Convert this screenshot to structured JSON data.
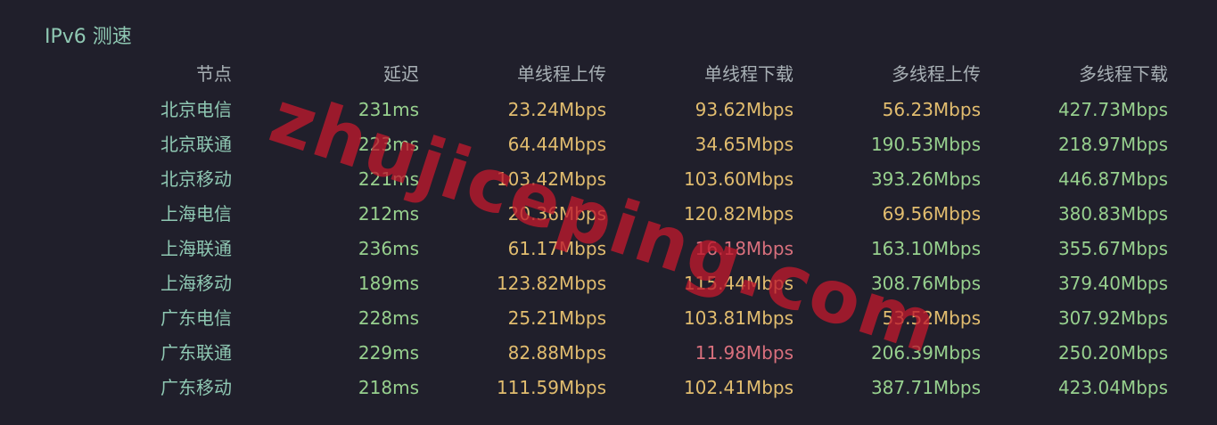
{
  "title": "IPv6 测速",
  "watermark": "zhujiceping.com",
  "colors": {
    "background": "#201f2b",
    "node_label": "#8fc8b3",
    "header": "#a8b0b5",
    "good": "#97d08e",
    "medium": "#e2bd6f",
    "poor": "#d9707d",
    "watermark": "#be192d"
  },
  "table": {
    "headers": [
      "节点",
      "延迟",
      "单线程上传",
      "单线程下载",
      "多线程上传",
      "多线程下载"
    ],
    "rows": [
      {
        "cells": [
          "北京电信",
          "231ms",
          "23.24Mbps",
          "93.62Mbps",
          "56.23Mbps",
          "427.73Mbps"
        ],
        "status": [
          "node",
          "good",
          "medium",
          "medium",
          "medium",
          "good"
        ]
      },
      {
        "cells": [
          "北京联通",
          "223ms",
          "64.44Mbps",
          "34.65Mbps",
          "190.53Mbps",
          "218.97Mbps"
        ],
        "status": [
          "node",
          "good",
          "medium",
          "medium",
          "good",
          "good"
        ]
      },
      {
        "cells": [
          "北京移动",
          "221ms",
          "103.42Mbps",
          "103.60Mbps",
          "393.26Mbps",
          "446.87Mbps"
        ],
        "status": [
          "node",
          "good",
          "medium",
          "medium",
          "good",
          "good"
        ]
      },
      {
        "cells": [
          "上海电信",
          "212ms",
          "20.36Mbps",
          "120.82Mbps",
          "69.56Mbps",
          "380.83Mbps"
        ],
        "status": [
          "node",
          "good",
          "medium",
          "medium",
          "medium",
          "good"
        ]
      },
      {
        "cells": [
          "上海联通",
          "236ms",
          "61.17Mbps",
          "16.18Mbps",
          "163.10Mbps",
          "355.67Mbps"
        ],
        "status": [
          "node",
          "good",
          "medium",
          "poor",
          "good",
          "good"
        ]
      },
      {
        "cells": [
          "上海移动",
          "189ms",
          "123.82Mbps",
          "115.44Mbps",
          "308.76Mbps",
          "379.40Mbps"
        ],
        "status": [
          "node",
          "good",
          "medium",
          "medium",
          "good",
          "good"
        ]
      },
      {
        "cells": [
          "广东电信",
          "228ms",
          "25.21Mbps",
          "103.81Mbps",
          "53.52Mbps",
          "307.92Mbps"
        ],
        "status": [
          "node",
          "good",
          "medium",
          "medium",
          "medium",
          "good"
        ]
      },
      {
        "cells": [
          "广东联通",
          "229ms",
          "82.88Mbps",
          "11.98Mbps",
          "206.39Mbps",
          "250.20Mbps"
        ],
        "status": [
          "node",
          "good",
          "medium",
          "poor",
          "good",
          "good"
        ]
      },
      {
        "cells": [
          "广东移动",
          "218ms",
          "111.59Mbps",
          "102.41Mbps",
          "387.71Mbps",
          "423.04Mbps"
        ],
        "status": [
          "node",
          "good",
          "medium",
          "medium",
          "good",
          "good"
        ]
      }
    ]
  }
}
